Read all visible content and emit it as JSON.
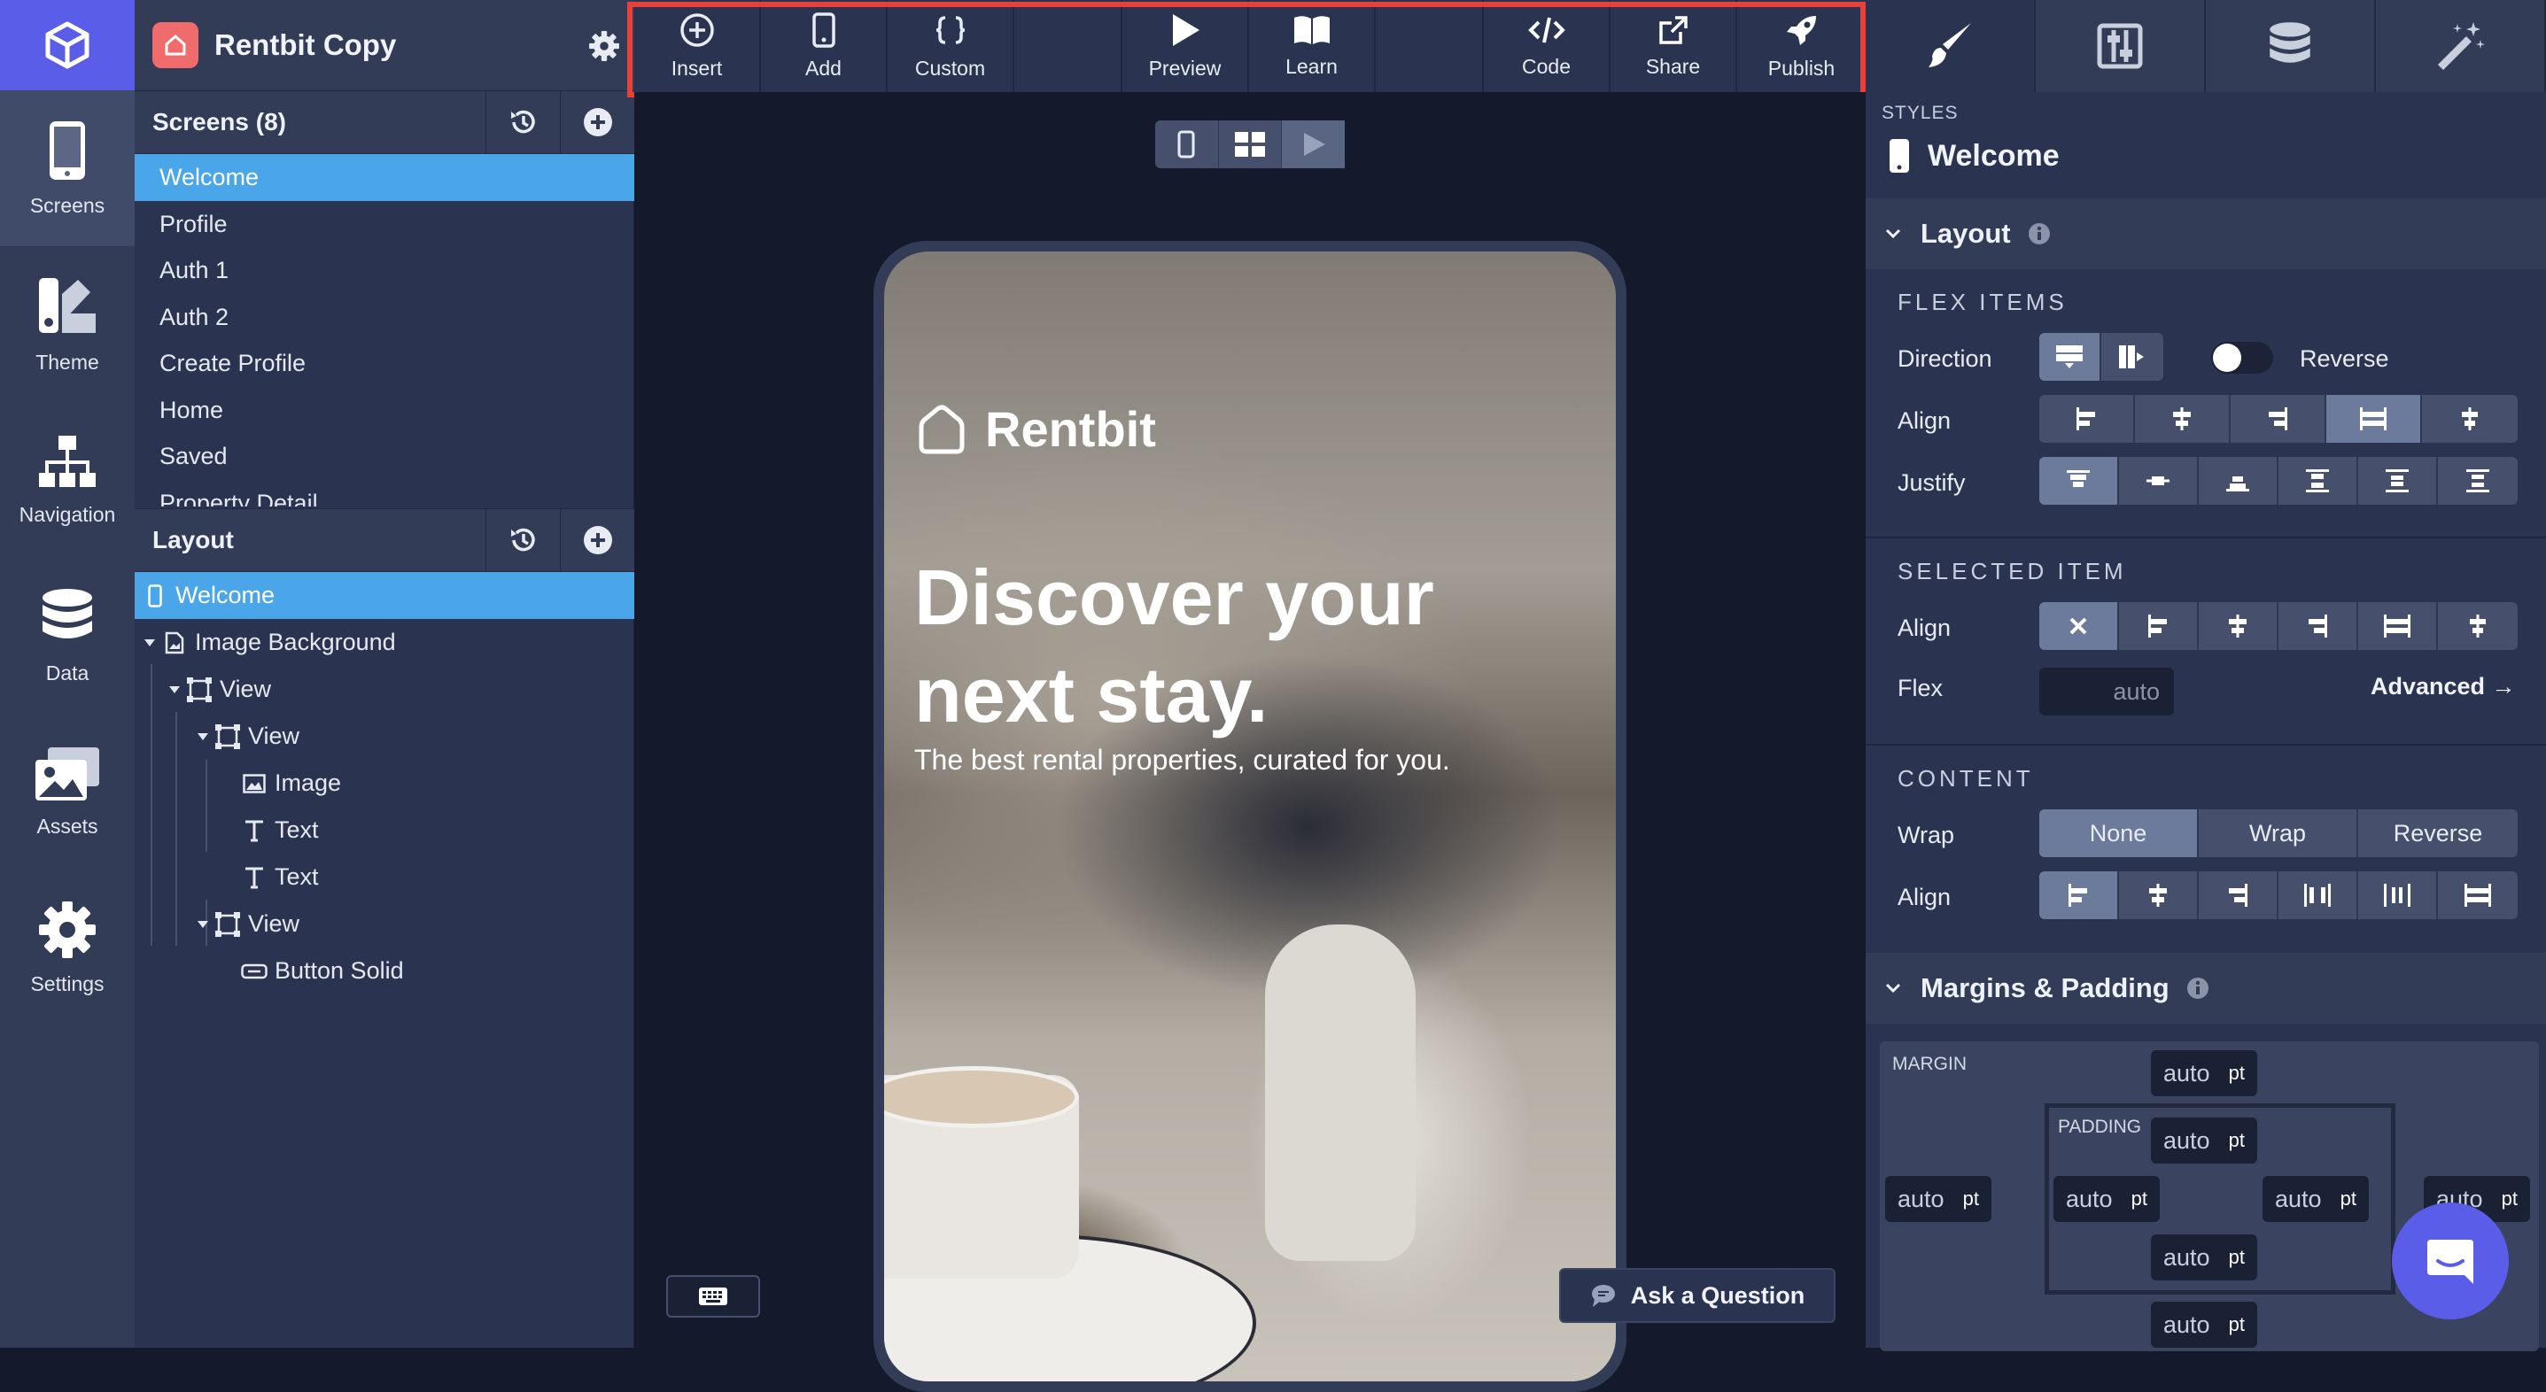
{
  "app": {
    "project_name": "Rentbit Copy"
  },
  "rail": {
    "items": [
      {
        "label": "Screens",
        "icon": "phone-icon"
      },
      {
        "label": "Theme",
        "icon": "theme-icon"
      },
      {
        "label": "Navigation",
        "icon": "sitemap-icon"
      },
      {
        "label": "Data",
        "icon": "database-icon"
      },
      {
        "label": "Assets",
        "icon": "images-icon"
      },
      {
        "label": "Settings",
        "icon": "gear-icon"
      }
    ]
  },
  "screens": {
    "title": "Screens (8)",
    "items": [
      "Welcome",
      "Profile",
      "Auth 1",
      "Auth 2",
      "Create Profile",
      "Home",
      "Saved",
      "Property Detail"
    ],
    "selected": "Welcome"
  },
  "layout": {
    "title": "Layout",
    "tree": [
      {
        "label": "Welcome",
        "icon": "phone-icon"
      },
      {
        "label": "Image Background",
        "icon": "image-background-icon"
      },
      {
        "label": "View",
        "icon": "view-icon"
      },
      {
        "label": "View",
        "icon": "view-icon"
      },
      {
        "label": "Image",
        "icon": "image-icon"
      },
      {
        "label": "Text",
        "icon": "text-icon"
      },
      {
        "label": "Text",
        "icon": "text-icon"
      },
      {
        "label": "View",
        "icon": "view-icon"
      },
      {
        "label": "Button Solid",
        "icon": "button-icon"
      }
    ]
  },
  "toolbar": {
    "insert": "Insert",
    "add": "Add",
    "custom": "Custom",
    "preview": "Preview",
    "learn": "Learn",
    "code": "Code",
    "share": "Share",
    "publish": "Publish",
    "highlight_color": "#e8413a"
  },
  "canvas": {
    "brand": "Rentbit",
    "headline": "Discover your next stay.",
    "subtitle": "The best rental properties, curated for you.",
    "ask_button": "Ask a Question"
  },
  "inspector": {
    "styles_label": "STYLES",
    "selected_screen": "Welcome",
    "layout_section": "Layout",
    "flex_items": "FLEX ITEMS",
    "direction": "Direction",
    "reverse": "Reverse",
    "align": "Align",
    "justify": "Justify",
    "selected_item": "SELECTED ITEM",
    "flex": "Flex",
    "flex_placeholder": "auto",
    "advanced": "Advanced →",
    "content": "CONTENT",
    "wrap": "Wrap",
    "wrap_options": [
      "None",
      "Wrap",
      "Reverse"
    ],
    "wrap_selected": "None",
    "margins_section": "Margins & Padding",
    "margin_label": "MARGIN",
    "padding_label": "PADDING",
    "field_value": "auto",
    "field_unit": "pt"
  },
  "colors": {
    "accent": "#5a5de8",
    "selection": "#4aa6e8",
    "app_icon": "#f06b6b"
  }
}
